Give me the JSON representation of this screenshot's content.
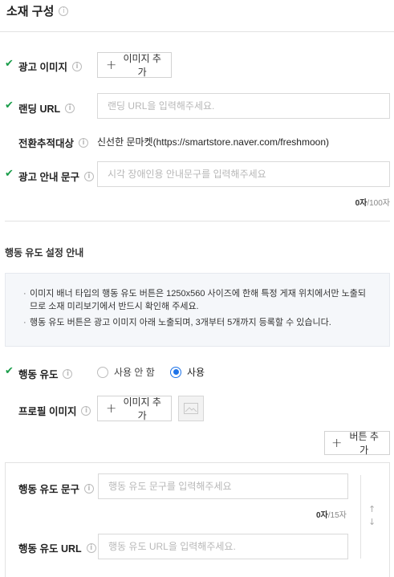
{
  "section": {
    "title": "소재 구성"
  },
  "fields": {
    "ad_image": {
      "label": "광고 이미지",
      "button": "이미지 추가"
    },
    "landing_url": {
      "label": "랜딩 URL",
      "placeholder": "랜딩 URL을 입력해주세요."
    },
    "conversion_target": {
      "label": "전환추적대상",
      "value": "신선한 문마켓(https://smartstore.naver.com/freshmoon)"
    },
    "ad_guide_text": {
      "label": "광고 안내 문구",
      "placeholder": "시각 장애인용 안내문구를 입력해주세요",
      "count": "0자",
      "max": "/100자"
    }
  },
  "cta_settings": {
    "title": "행동 유도 설정 안내",
    "notice_line1": "이미지 배너 타입의 행동 유도 버튼은 1250x560 사이즈에 한해 특정 게재 위치에서만 노출되므로 소재 미리보기에서 반드시 확인해 주세요.",
    "notice_line2": "행동 유도 버튼은 광고 이미지 아래 노출되며, 3개부터 5개까지 등록할 수 있습니다.",
    "cta_label": "행동 유도",
    "option_off": "사용 안 함",
    "option_on": "사용",
    "selected": "사용",
    "profile_label": "프로필 이미지",
    "profile_button": "이미지 추가",
    "add_button": "버튼 추가"
  },
  "cta_item": {
    "text_label": "행동 유도 문구",
    "text_placeholder": "행동 유도 문구를 입력해주세요",
    "count": "0자",
    "max": "/15자",
    "url_label": "행동 유도 URL",
    "url_placeholder": "행동 유도 URL을 입력해주세요."
  },
  "icons": [
    "info-icon",
    "check-icon",
    "plus-icon",
    "image-placeholder-icon",
    "arrow-up-icon",
    "arrow-down-icon"
  ],
  "colors": {
    "check": "#1a9d4a",
    "radio_active": "#1e73e8",
    "notice_bg": "#f5f7fa"
  }
}
